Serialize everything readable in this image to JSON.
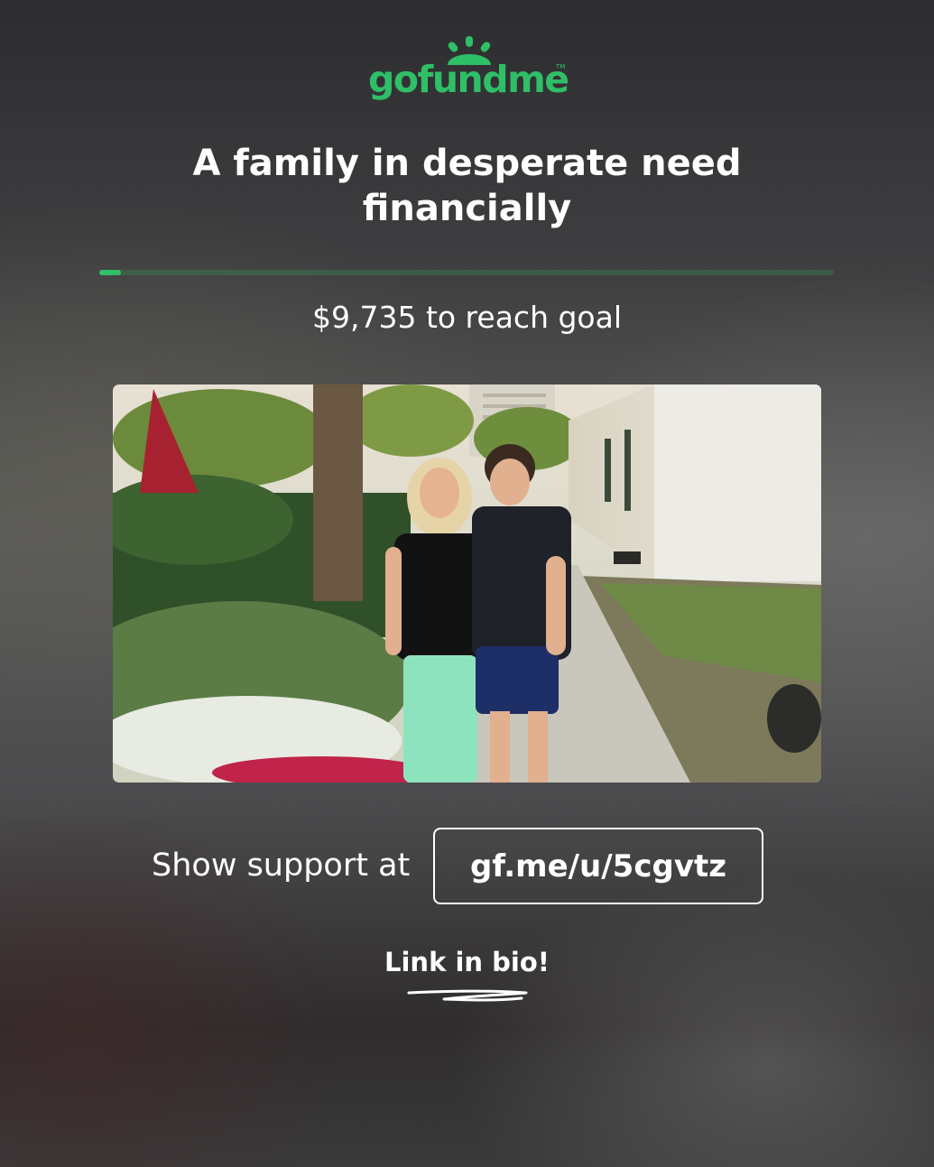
{
  "brand": {
    "logo_text": "gofundme",
    "trademark": "TM",
    "color": "#2fbf67"
  },
  "campaign": {
    "title": "A family in desperate need financially",
    "progress_fraction": 0.03,
    "goal_text": "$9,735 to reach goal",
    "photo": "photo of a woman and a teenage boy standing on a sidewalk beside palm trees, hedges and a white building"
  },
  "cta": {
    "label": "Show support at",
    "link": "gf.me/u/5cgvtz",
    "bio_text": "Link in bio!"
  },
  "icons": {
    "logo": "gofundme-sun-logo-icon",
    "underline": "hand-drawn-underline-icon"
  }
}
